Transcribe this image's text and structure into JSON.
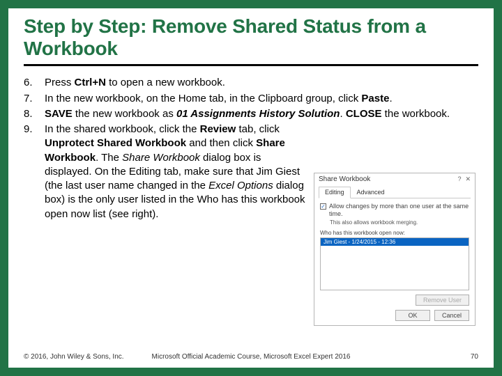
{
  "title": "Step by Step: Remove Shared Status from a Workbook",
  "steps": {
    "s6": {
      "num": "6.",
      "pre": "Press ",
      "key": "Ctrl+N",
      "post": " to open a new workbook."
    },
    "s7": {
      "num": "7.",
      "pre": "In the new workbook, on the Home tab, in the Clipboard group, click ",
      "bold": "Paste",
      "post": "."
    },
    "s8": {
      "num": "8.",
      "a": "SAVE",
      "b": " the new workbook as ",
      "c": "01 Assignments History Solution",
      "d": ". ",
      "e": "CLOSE",
      "f": " the workbook."
    },
    "s9": {
      "num": "9.",
      "t1": "In the shared workbook, click the ",
      "b1": "Review",
      "t2": " tab, click ",
      "b2": "Unprotect Shared Workbook",
      "t3": " and then click ",
      "b3": "Share Workbook",
      "t4": ". The ",
      "i1": "Share Workbook",
      "t5": " dialog box is displayed. On the Editing tab, make sure that Jim Giest (the last user name changed in the ",
      "i2": "Excel Options",
      "t6": " dialog box) is the only user listed in the Who has this workbook open now list (see right)."
    }
  },
  "dialog": {
    "title": "Share Workbook",
    "help": "?",
    "close": "✕",
    "tab1": "Editing",
    "tab2": "Advanced",
    "allow": "Allow changes by more than one user at the same time.",
    "allow2": "This also allows workbook merging.",
    "who": "Who has this workbook open now:",
    "user": "Jim Giest - 1/24/2015 - 12:36",
    "remove": "Remove User",
    "ok": "OK",
    "cancel": "Cancel"
  },
  "footer": {
    "left": "© 2016, John Wiley & Sons, Inc.",
    "mid": "Microsoft Official Academic Course, Microsoft Excel Expert 2016",
    "right": "70"
  }
}
